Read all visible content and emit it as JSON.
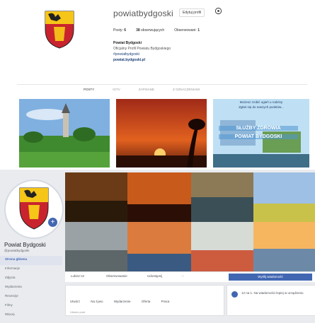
{
  "instagram": {
    "username": "powiatbydgoski",
    "edit_profile": "Edytuj profil",
    "stats": {
      "posts_label": "Posty:",
      "posts_value": "6",
      "followers_value": "38",
      "followers_label": "obserwujących",
      "following_label": "Obserwowani:",
      "following_value": "1"
    },
    "bio": {
      "name": "Powiat Bydgoski",
      "line1": "Oficjalny Profil Powiatu Bydgoskiego",
      "hashtag": "#powiatbydgoski",
      "website": "powiat.bydgoski.pl"
    },
    "tabs": [
      "POSTY",
      "IGTV",
      "ZAPISANE",
      "Z OZNACZENIAMI"
    ],
    "tiles": [
      {
        "kind": "landscape"
      },
      {
        "kind": "sunset"
      },
      {
        "kind": "ad",
        "small_text": "Możesz zrobić ogień u rodziny",
        "sub_text": "Zgłoś się do naszych punktów...",
        "big_line1": "SŁUŻBY ZDROWIA",
        "big_line2": "POWIAT BYDGOSKI"
      }
    ]
  },
  "facebook": {
    "page_name": "Powiat Bydgoski",
    "handle": "@powiatbydgoski",
    "nav": [
      "Strona główna",
      "Informacje",
      "Zdjęcia",
      "Wydarzenia",
      "Recenzje",
      "Filmy",
      "Więcej"
    ],
    "actions": [
      "Lubisz to!",
      "Obserwowanie",
      "Udostępnij",
      "···"
    ],
    "send_message": "Wyślij wiadomość",
    "post_box": {
      "options": [
        "Utwórz",
        "Na żywo",
        "Wydarzenie",
        "Oferta",
        "Praca"
      ],
      "footer": "Utwórz post"
    },
    "side_box_text": "12 na 1. Na wiadomości lepiej w urządzeniu"
  }
}
